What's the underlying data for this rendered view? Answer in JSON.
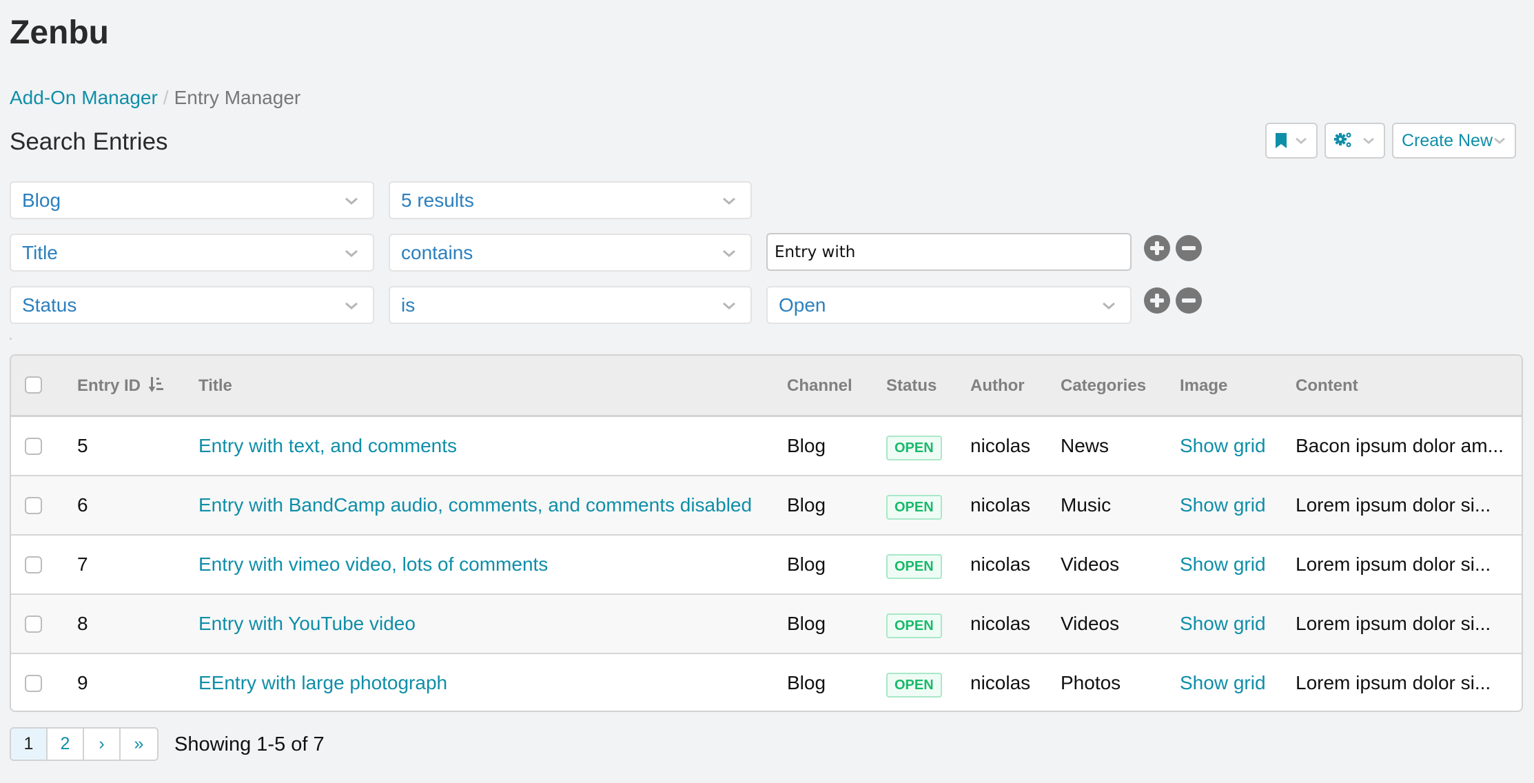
{
  "app": {
    "title": "Zenbu"
  },
  "breadcrumb": {
    "parent": "Add-On Manager",
    "separator": "/",
    "current": "Entry Manager"
  },
  "page": {
    "title": "Search Entries"
  },
  "toolbar": {
    "bookmark_icon": "bookmark-icon",
    "settings_icon": "gears-icon",
    "create_new_label": "Create New"
  },
  "colors": {
    "link": "#0f8ea8",
    "select_text": "#2b7fbe",
    "status_open": "#19b96a",
    "background": "#f2f3f5"
  },
  "filters": {
    "channel": "Blog",
    "limit": "5 results",
    "rules": [
      {
        "field": "Title",
        "operator": "contains",
        "value": "Entry with",
        "value_type": "text"
      },
      {
        "field": "Status",
        "operator": "is",
        "value": "Open",
        "value_type": "select"
      }
    ]
  },
  "table": {
    "columns": [
      "Entry ID",
      "Title",
      "Channel",
      "Status",
      "Author",
      "Categories",
      "Image",
      "Content"
    ],
    "sort": {
      "column": "Entry ID",
      "direction": "ascending"
    },
    "rows": [
      {
        "id": "5",
        "title": "Entry with text, and comments",
        "channel": "Blog",
        "status": "OPEN",
        "author": "nicolas",
        "categories": "News",
        "image": "Show grid",
        "content": "Bacon ipsum dolor am..."
      },
      {
        "id": "6",
        "title": "Entry with BandCamp audio, comments, and comments disabled",
        "channel": "Blog",
        "status": "OPEN",
        "author": "nicolas",
        "categories": "Music",
        "image": "Show grid",
        "content": "Lorem ipsum dolor si..."
      },
      {
        "id": "7",
        "title": "Entry with vimeo video, lots of comments",
        "channel": "Blog",
        "status": "OPEN",
        "author": "nicolas",
        "categories": "Videos",
        "image": "Show grid",
        "content": "Lorem ipsum dolor si..."
      },
      {
        "id": "8",
        "title": "Entry with YouTube video",
        "channel": "Blog",
        "status": "OPEN",
        "author": "nicolas",
        "categories": "Videos",
        "image": "Show grid",
        "content": "Lorem ipsum dolor si..."
      },
      {
        "id": "9",
        "title": "EEntry with large photograph",
        "channel": "Blog",
        "status": "OPEN",
        "author": "nicolas",
        "categories": "Photos",
        "image": "Show grid",
        "content": "Lorem ipsum dolor si..."
      }
    ]
  },
  "pagination": {
    "pages": [
      "1",
      "2"
    ],
    "current": "1",
    "next_label": "›",
    "last_label": "»",
    "status": "Showing 1-5 of 7"
  }
}
